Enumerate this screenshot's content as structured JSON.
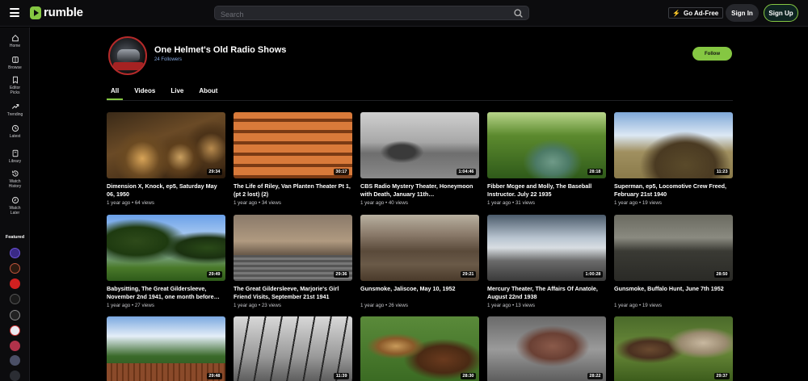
{
  "header": {
    "logo_text": "rumble",
    "search_placeholder": "Search",
    "ad_free_label": "Go Ad-Free",
    "sign_in_label": "Sign In",
    "sign_up_label": "Sign Up",
    "accent_color": "#85c742"
  },
  "sidebar": {
    "items": [
      {
        "label": "Home",
        "icon": "home-icon"
      },
      {
        "label": "Browse",
        "icon": "browse-icon"
      },
      {
        "label": "Editor Picks",
        "icon": "editor-picks-icon"
      },
      {
        "label": "Trending",
        "icon": "trending-icon"
      },
      {
        "label": "Latest",
        "icon": "clock-icon"
      },
      {
        "label": "Library",
        "icon": "library-icon"
      },
      {
        "label": "Watch History",
        "icon": "history-icon"
      },
      {
        "label": "Watch Later",
        "icon": "watch-later-icon"
      }
    ],
    "featured_label": "Featured"
  },
  "channel": {
    "name": "One Helmet's Old Radio Shows",
    "followers": "24 Followers",
    "follow_label": "Follow"
  },
  "tabs": [
    {
      "label": "All",
      "active": true
    },
    {
      "label": "Videos",
      "active": false
    },
    {
      "label": "Live",
      "active": false
    },
    {
      "label": "About",
      "active": false
    }
  ],
  "videos": [
    {
      "title": "Dimension X, Knock, ep5, Saturday May 06, 1950",
      "meta": "1 year ago • 64 views",
      "duration": "29:34"
    },
    {
      "title": "The Life of Riley, Van Planten Theater Pt 1, (pt 2 lost) (2)",
      "meta": "1 year ago • 34 views",
      "duration": "30:17"
    },
    {
      "title": "CBS Radio Mystery Theater, Honeymoon with Death, January 11th…",
      "meta": "1 year ago • 40 views",
      "duration": "1:04:46"
    },
    {
      "title": "Fibber Mcgee and Molly, The Baseball Instructor. July 22 1935",
      "meta": "1 year ago • 31 views",
      "duration": "28:18"
    },
    {
      "title": "Superman, ep5, Locomotive Crew Freed, February 21st 1940",
      "meta": "1 year ago • 19 views",
      "duration": "11:23"
    },
    {
      "title": "Babysitting, The Great Gildersleeve, November 2nd 1941, one month before…",
      "meta": "1 year ago • 27 views",
      "duration": "29:49"
    },
    {
      "title": "The Great Gildersleeve, Marjorie's Girl Friend Visits, September 21st 1941",
      "meta": "1 year ago • 23 views",
      "duration": "29:36"
    },
    {
      "title": "Gunsmoke, Jaliscoe, May 10, 1952",
      "meta": "1 year ago • 26 views",
      "duration": "29:21"
    },
    {
      "title": "Mercury Theater, The Affairs Of Anatole, August 22nd 1938",
      "meta": "1 year ago • 13 views",
      "duration": "1:00:28"
    },
    {
      "title": "Gunsmoke, Buffalo Hunt, June 7th 1952",
      "meta": "1 year ago • 19 views",
      "duration": "28:50"
    },
    {
      "title": "",
      "meta": "",
      "duration": "29:48"
    },
    {
      "title": "",
      "meta": "",
      "duration": "11:39"
    },
    {
      "title": "",
      "meta": "",
      "duration": "28:30"
    },
    {
      "title": "",
      "meta": "",
      "duration": "28:22"
    },
    {
      "title": "",
      "meta": "",
      "duration": "29:37"
    }
  ]
}
